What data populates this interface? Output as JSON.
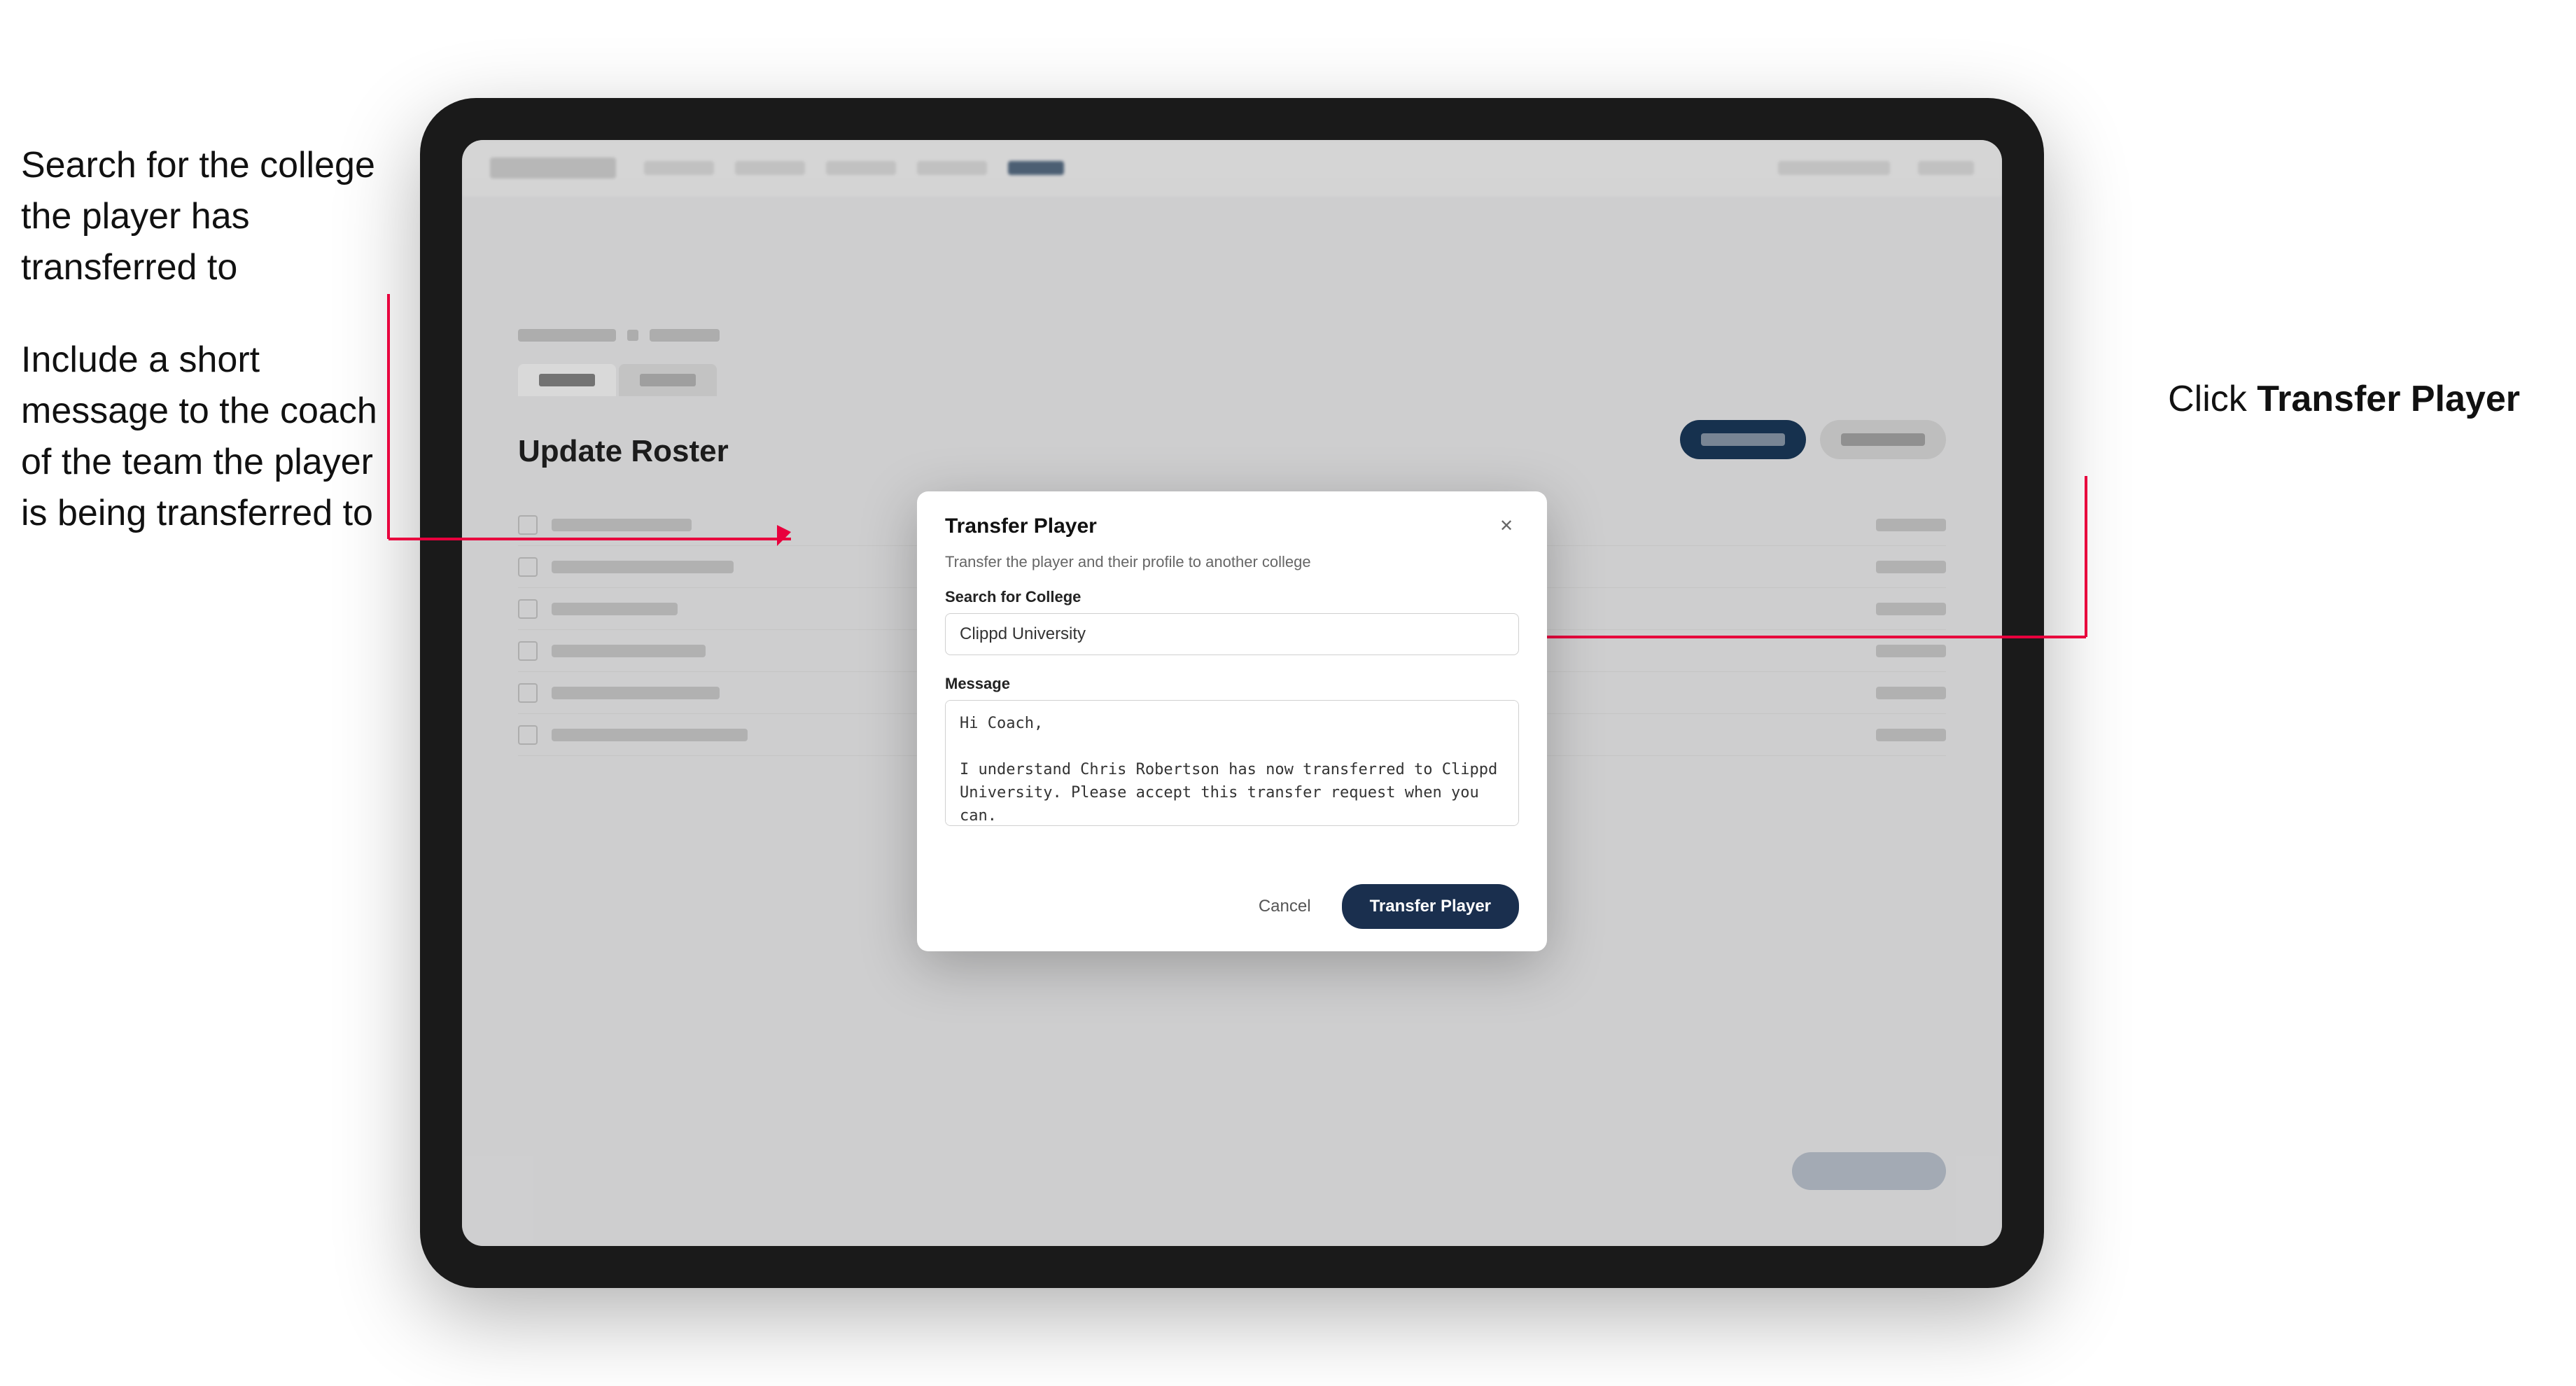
{
  "annotations": {
    "left_title1": "Search for the college the player has transferred to",
    "left_title2": "Include a short message to the coach of the team the player is being transferred to",
    "right_label_prefix": "Click ",
    "right_label_bold": "Transfer Player"
  },
  "modal": {
    "title": "Transfer Player",
    "subtitle": "Transfer the player and their profile to another college",
    "search_label": "Search for College",
    "search_value": "Clippd University",
    "message_label": "Message",
    "message_value": "Hi Coach,\n\nI understand Chris Robertson has now transferred to Clippd University. Please accept this transfer request when you can.",
    "cancel_label": "Cancel",
    "transfer_label": "Transfer Player"
  },
  "background": {
    "page_title": "Update Roster"
  }
}
